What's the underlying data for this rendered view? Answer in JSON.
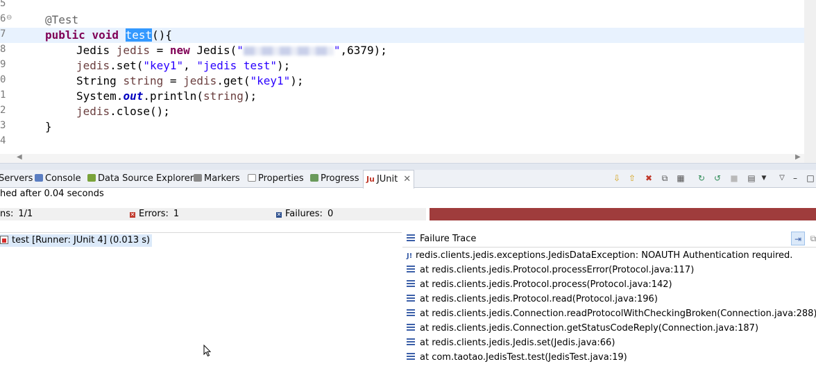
{
  "editor": {
    "line_numbers": [
      "5",
      "6",
      "7",
      "8",
      "9",
      "0",
      "1",
      "2",
      "3",
      "4"
    ],
    "annotation": "@Test",
    "kw_public": "public",
    "kw_void": "void",
    "method_name": "test",
    "after_method": "(){",
    "line8": {
      "type": "Jedis ",
      "var": "jedis",
      "eq": " = ",
      "kw": "new",
      "ctor": " Jedis(",
      "q1": "\"",
      "q2": "\"",
      "port": ",6379);"
    },
    "line9": {
      "obj": "jedis",
      "call": ".set(",
      "a1": "\"key1\"",
      "sep": ", ",
      "a2": "\"jedis test\"",
      "end": ");"
    },
    "line10": {
      "type": "String ",
      "var": "string",
      "eq": " = ",
      "obj": "jedis",
      "call": ".get(",
      "a1": "\"key1\"",
      "end": ");"
    },
    "line11": {
      "a": "System.",
      "field": "out",
      "b": ".println(",
      "var": "string",
      "end": ");"
    },
    "line12": {
      "obj": "jedis",
      "call": ".close();"
    },
    "line13": "}"
  },
  "tabs": [
    "Servers",
    "Console",
    "Data Source Explorer",
    "Markers",
    "Properties",
    "Progress",
    "JUnit"
  ],
  "junit": {
    "status": "hed after 0.04 seconds",
    "runs_label": "ns:",
    "runs_value": "1/1",
    "errors_label": "Errors:",
    "errors_value": "1",
    "failures_label": "Failures:",
    "failures_value": "0",
    "progress": 1.0,
    "progress_color": "#9f3c3c",
    "test_item": "test [Runner: JUnit 4] (0.013 s)",
    "trace_title": "Failure Trace",
    "trace": [
      "redis.clients.jedis.exceptions.JedisDataException: NOAUTH Authentication required.",
      "at redis.clients.jedis.Protocol.processError(Protocol.java:117)",
      "at redis.clients.jedis.Protocol.process(Protocol.java:142)",
      "at redis.clients.jedis.Protocol.read(Protocol.java:196)",
      "at redis.clients.jedis.Connection.readProtocolWithCheckingBroken(Connection.java:288)",
      "at redis.clients.jedis.Connection.getStatusCodeReply(Connection.java:187)",
      "at redis.clients.jedis.Jedis.set(Jedis.java:66)",
      "at com.taotao.JedisTest.test(JedisTest.java:19)"
    ]
  }
}
